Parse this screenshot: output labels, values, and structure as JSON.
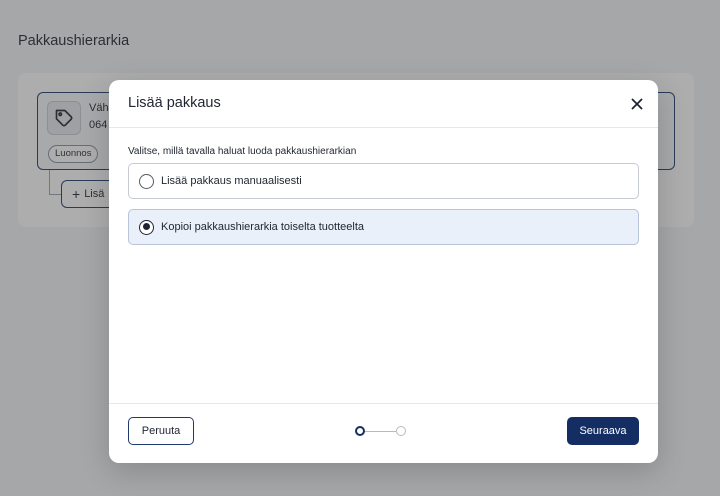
{
  "page": {
    "title": "Pakkaushierarkia"
  },
  "package_card": {
    "name_partial": "Vähi",
    "code_partial": "064",
    "status_badge": "Luonnos",
    "icon": "tag-icon",
    "add_button_label": "Lisä",
    "add_icon": "plus-icon"
  },
  "modal": {
    "title": "Lisää pakkaus",
    "close_icon": "close-icon",
    "prompt": "Valitse, millä tavalla haluat luoda pakkaushierarkian",
    "options": [
      {
        "label": "Lisää pakkaus manuaalisesti",
        "selected": false
      },
      {
        "label": "Kopioi pakkaushierarkia toiselta tuotteelta",
        "selected": true
      }
    ],
    "footer": {
      "cancel_label": "Peruuta",
      "next_label": "Seuraava",
      "step_current": 1,
      "step_total": 2
    }
  },
  "colors": {
    "primary": "#142e63",
    "selected_bg": "#eaf0fa",
    "overlay": "rgba(60,60,60,0.42)"
  }
}
